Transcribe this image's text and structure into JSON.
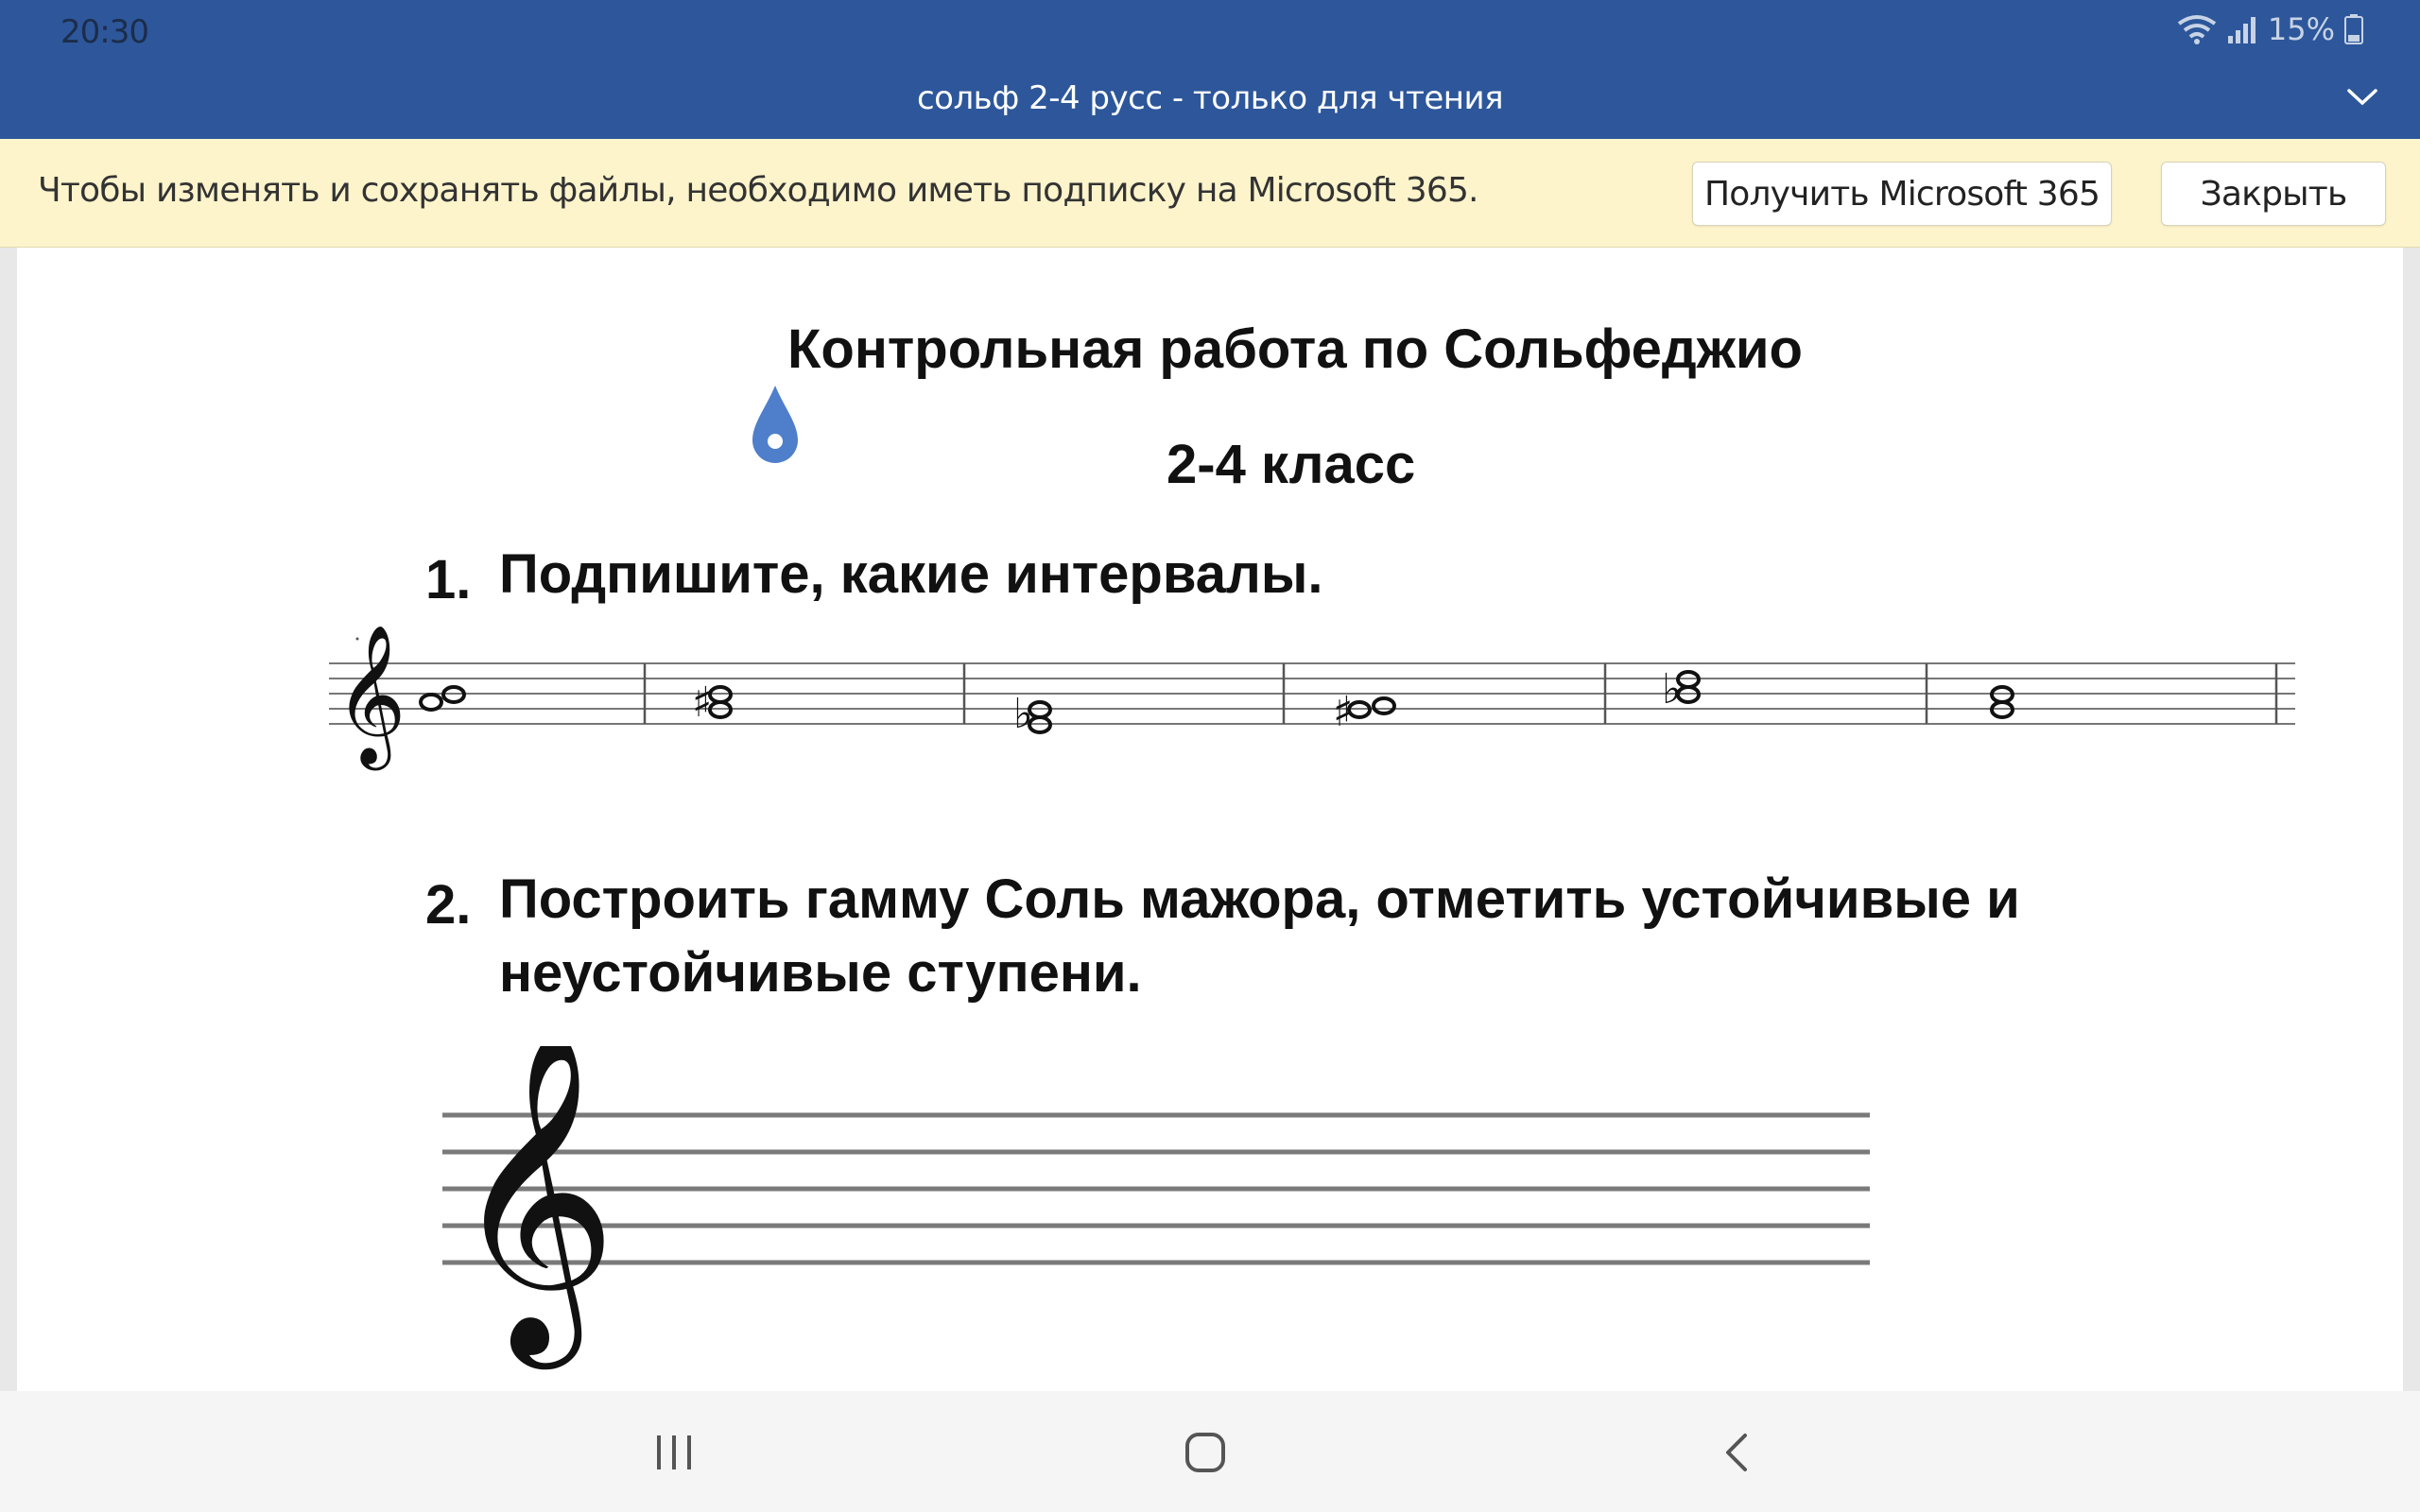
{
  "status": {
    "time": "20:30",
    "battery": "15%"
  },
  "titlebar": {
    "title": "сольф 2-4 русс - только для чтения"
  },
  "banner": {
    "message": "Чтобы изменять и сохранять файлы, необходимо иметь подписку на Microsoft 365.",
    "get_button": "Получить Microsoft 365",
    "close_button": "Закрыть"
  },
  "document": {
    "heading": "Контрольная работа по Сольфеджио",
    "subheading": "2-4 класс",
    "q1_num": "1.",
    "q1_text": "Подпишите, какие интервалы.",
    "q2_num": "2.",
    "q2_line1": "Построить гамму Соль мажора, отметить устойчивые и",
    "q2_line2": "неустойчивые ступени."
  },
  "colors": {
    "titlebar": "#2d579a",
    "banner": "#fdf4cc",
    "cursor": "#4f7fcb"
  },
  "icons": [
    "wifi-icon",
    "signal-icon",
    "battery-icon",
    "chevron-down-icon",
    "recent-apps-icon",
    "home-icon",
    "back-icon",
    "text-cursor-handle-icon",
    "treble-clef-icon"
  ]
}
